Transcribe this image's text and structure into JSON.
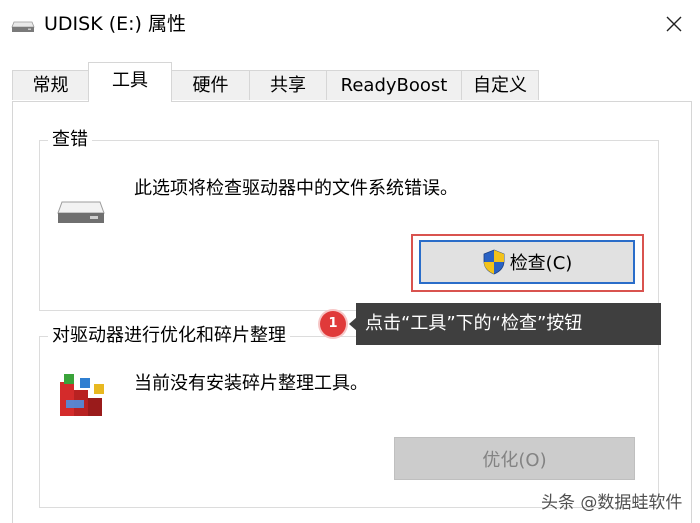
{
  "window": {
    "title": "UDISK (E:) 属性",
    "close_icon": "close-icon",
    "drive_icon": "drive-icon"
  },
  "tabs": [
    {
      "label": "常规",
      "active": false
    },
    {
      "label": "工具",
      "active": true
    },
    {
      "label": "硬件",
      "active": false
    },
    {
      "label": "共享",
      "active": false
    },
    {
      "label": "ReadyBoost",
      "active": false
    },
    {
      "label": "自定义",
      "active": false
    }
  ],
  "error_checking": {
    "group_label": "查错",
    "description": "此选项将检查驱动器中的文件系统错误。",
    "check_button_label": "检查(C)",
    "icon": "drive-icon",
    "button_icon": "uac-shield-icon"
  },
  "optimize": {
    "group_label": "对驱动器进行优化和碎片整理",
    "description": "当前没有安装碎片整理工具。",
    "optimize_button_label": "优化(O)",
    "optimize_button_enabled": false,
    "icon": "defrag-icon"
  },
  "annotation": {
    "step_number": "1",
    "text": "点击“工具”下的“检查”按钮"
  },
  "watermark": "头条 @数据蛙软件",
  "colors": {
    "highlight": "#d9534f",
    "button_border": "#2a6dc9",
    "annotation_bg": "#3f3f3f",
    "badge": "#e03a3a"
  }
}
